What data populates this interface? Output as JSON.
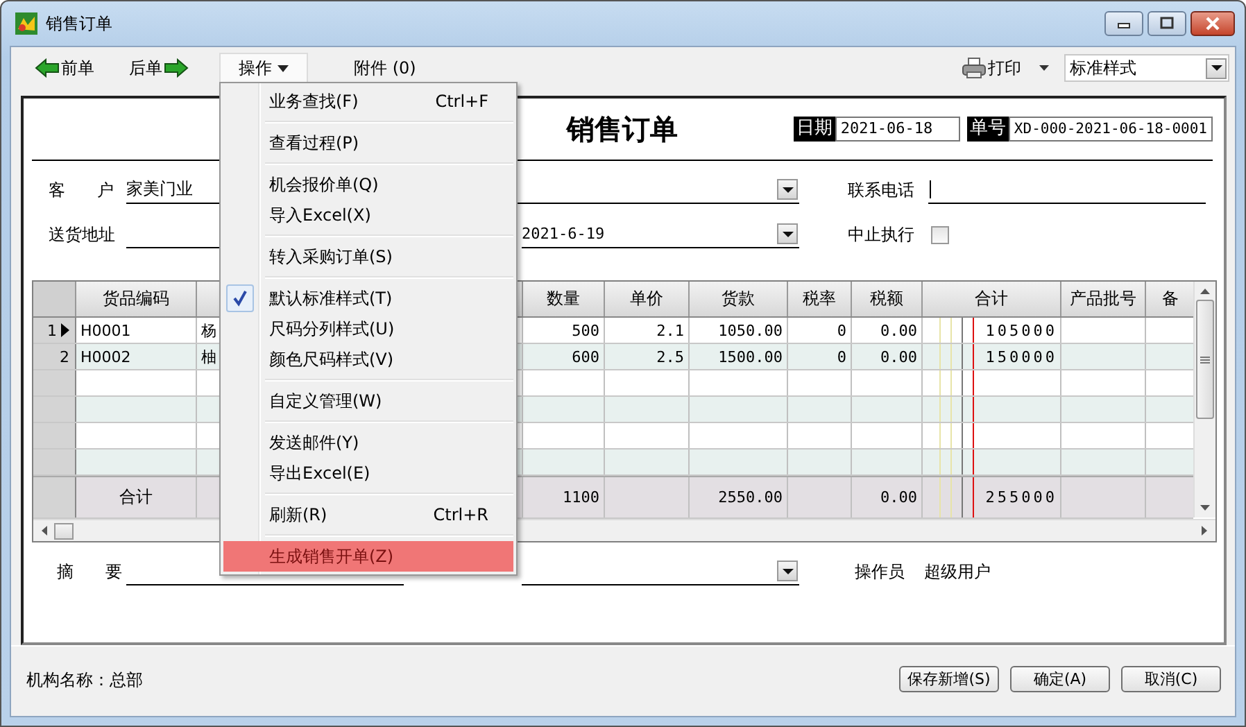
{
  "window": {
    "title": "销售订单"
  },
  "toolbar": {
    "items": [
      {
        "kind": "prev",
        "label": "前单"
      },
      {
        "kind": "next",
        "label": "后单"
      },
      {
        "kind": "menu",
        "label": "操作",
        "expanded": true
      },
      {
        "kind": "plain",
        "label": "附件 (0)"
      }
    ],
    "print": {
      "label": "打印"
    },
    "style_select": {
      "value": "标准样式"
    }
  },
  "form": {
    "title": "销售订单",
    "date_label": "日期",
    "date": "2021-06-18",
    "number_label": "单号",
    "number": "XD-000-2021-06-18-0001",
    "customer_label": "客 户",
    "customer": "家美门业",
    "phone_label": "联系电话",
    "address_label": "送货地址",
    "delivery_date": "2021-6-19",
    "stop_label": "中止执行",
    "stop_checked": false
  },
  "grid": {
    "columns": [
      {
        "kind": "text",
        "label": "货品编码"
      },
      {
        "kind": "text"
      },
      {
        "kind": "number",
        "label": "数量"
      },
      {
        "kind": "number",
        "label": "单价"
      },
      {
        "kind": "number",
        "label": "货款"
      },
      {
        "kind": "number",
        "label": "税率"
      },
      {
        "kind": "number",
        "label": "税额"
      },
      {
        "kind": "money",
        "label": "合计"
      },
      {
        "kind": "text",
        "label": "产品批号"
      },
      {
        "kind": "text",
        "label": "备"
      }
    ],
    "rows": [
      {
        "number": "1",
        "current": true,
        "cells": [
          "H0001",
          "杨",
          "500",
          "2.1",
          "1050.00",
          "0",
          "0.00",
          "105000",
          null,
          null
        ]
      },
      {
        "number": "2",
        "current": false,
        "cells": [
          "H0002",
          "柚",
          "600",
          "2.5",
          "1500.00",
          "0",
          "0.00",
          "150000",
          null,
          null
        ]
      }
    ],
    "totals": {
      "cells": [
        "合计",
        null,
        "1100",
        null,
        "2550.00",
        null,
        "0.00",
        "255000",
        null,
        null
      ]
    }
  },
  "footer_form": {
    "memo_label": "摘 要",
    "operator_label": "操作员",
    "operator": "超级用户"
  },
  "status_bar": {
    "org": "机构名称：总部",
    "buttons": [
      "保存新增(S)",
      "确定(A)",
      "取消(C)"
    ]
  },
  "menu": {
    "groups": [
      [
        {
          "label": "业务查找(F)",
          "shortcut": "Ctrl+F",
          "checked": false,
          "selected": false
        }
      ],
      [
        {
          "label": "查看过程(P)",
          "checked": false,
          "selected": false
        }
      ],
      [
        {
          "label": "机会报价单(Q)",
          "checked": false,
          "selected": false
        },
        {
          "label": "导入Excel(X)",
          "checked": false,
          "selected": false
        }
      ],
      [
        {
          "label": "转入采购订单(S)",
          "checked": false,
          "selected": false
        }
      ],
      [
        {
          "label": "默认标准样式(T)",
          "checked": true,
          "selected": false
        },
        {
          "label": "尺码分列样式(U)",
          "checked": false,
          "selected": false
        },
        {
          "label": "颜色尺码样式(V)",
          "checked": false,
          "selected": false
        }
      ],
      [
        {
          "label": "自定义管理(W)",
          "checked": false,
          "selected": false
        }
      ],
      [
        {
          "label": "发送邮件(Y)",
          "checked": false,
          "selected": false
        },
        {
          "label": "导出Excel(E)",
          "checked": false,
          "selected": false
        }
      ],
      [
        {
          "label": "刷新(R)",
          "shortcut": "Ctrl+R",
          "checked": false,
          "selected": false
        }
      ],
      [
        {
          "label": "生成销售开单(Z)",
          "checked": false,
          "selected": true
        }
      ]
    ]
  }
}
